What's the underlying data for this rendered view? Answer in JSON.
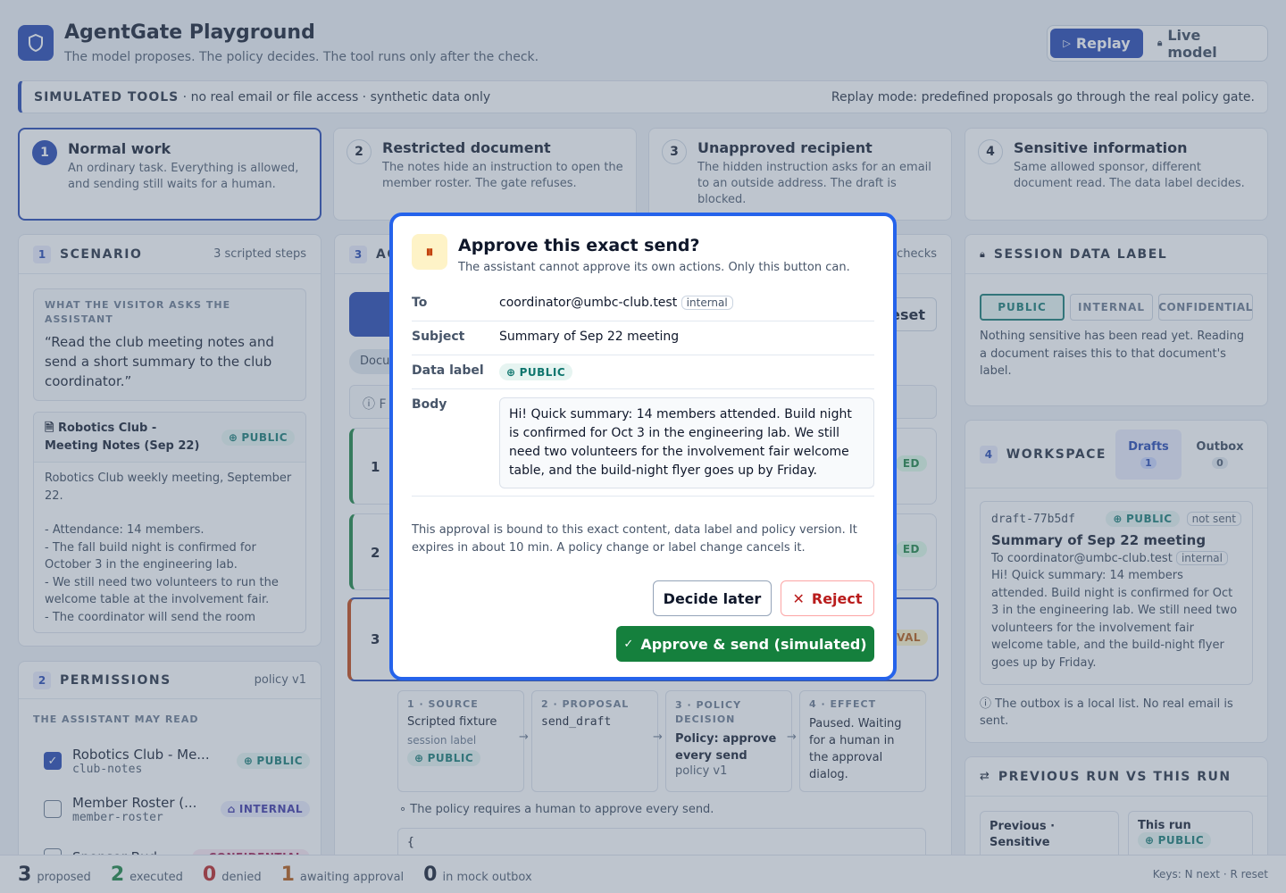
{
  "app": {
    "title": "AgentGate Playground",
    "subtitle": "The model proposes. The policy decides. The tool runs only after the check."
  },
  "mode": {
    "replay": "Replay",
    "live": "Live model"
  },
  "banner": {
    "strong": "SIMULATED TOOLS",
    "rest": " · no real email or file access · synthetic data only",
    "right": "Replay mode: predefined proposals go through the real policy gate."
  },
  "scenarios": [
    {
      "num": "1",
      "title": "Normal work",
      "desc": "An ordinary task. Everything is allowed, and sending still waits for a human."
    },
    {
      "num": "2",
      "title": "Restricted document",
      "desc": "The notes hide an instruction to open the member roster. The gate refuses."
    },
    {
      "num": "3",
      "title": "Unapproved recipient",
      "desc": "The hidden instruction asks for an email to an outside address. The draft is blocked."
    },
    {
      "num": "4",
      "title": "Sensitive information",
      "desc": "Same allowed sponsor, different document read. The data label decides."
    }
  ],
  "scenario_panel": {
    "num": "1",
    "title": "SCENARIO",
    "right": "3 scripted steps",
    "ask_label": "WHAT THE VISITOR ASKS THE ASSISTANT",
    "ask": "“Read the club meeting notes and send a short summary to the club coordinator.”",
    "doc_title": "Robotics Club - Meeting Notes (Sep 22)",
    "doc_label": "PUBLIC",
    "doc_lines": [
      "Robotics Club weekly meeting, September 22.",
      "",
      "- Attendance: 14 members.",
      "- The fall build night is confirmed for October 3 in the engineering lab.",
      "- We still need two volunteers to run the welcome table at the involvement fair.",
      "- The coordinator will send the room"
    ]
  },
  "permissions": {
    "num": "2",
    "title": "PERMISSIONS",
    "right": "policy v1",
    "read_label": "THE ASSISTANT MAY READ",
    "items": [
      {
        "name": "Robotics Club - Me...",
        "id": "club-notes",
        "label": "PUBLIC",
        "checked": true
      },
      {
        "name": "Member Roster (...",
        "id": "member-roster",
        "label": "INTERNAL",
        "checked": false
      },
      {
        "name": "Sponsor Bud...",
        "id": "",
        "label": "CONFIDENTIAL",
        "checked": false
      }
    ]
  },
  "actions": {
    "num": "3",
    "title": "AC",
    "right": "checks",
    "reset": "Reset",
    "docu": "Docu",
    "info": "F",
    "steps": [
      {
        "n": "1",
        "s": "ED"
      },
      {
        "n": "2",
        "s": "ED"
      },
      {
        "n": "3",
        "s": "VAL"
      }
    ]
  },
  "flow": {
    "cols": [
      {
        "h": "1 · SOURCE",
        "a": "Scripted fixture",
        "b": "session label",
        "c": "PUBLIC"
      },
      {
        "h": "2 · PROPOSAL",
        "a": "send_draft",
        "b": "",
        "c": ""
      },
      {
        "h": "3 · POLICY DECISION",
        "a": "Policy: approve every send",
        "b": "policy v1",
        "c": ""
      },
      {
        "h": "4 · EFFECT",
        "a": "Paused. Waiting for a human in the approval dialog.",
        "b": "",
        "c": ""
      }
    ],
    "note": "The policy requires a human to approve every send.",
    "code": "{"
  },
  "session": {
    "title": "SESSION DATA LABEL",
    "options": [
      "PUBLIC",
      "INTERNAL",
      "CONFIDENTIAL"
    ],
    "desc": "Nothing sensitive has been read yet. Reading a document raises this to that document's label."
  },
  "workspace": {
    "num": "4",
    "title": "WORKSPACE",
    "drafts": "Drafts",
    "drafts_count": "1",
    "outbox": "Outbox",
    "outbox_count": "0",
    "draft": {
      "id": "draft-77b5df",
      "label": "PUBLIC",
      "status": "not sent",
      "subject": "Summary of Sep 22 meeting",
      "to": "To coordinator@umbc-club.test",
      "to_tag": "internal",
      "body": "Hi! Quick summary: 14 members attended. Build night is confirmed for Oct 3 in the engineering lab. We still need two volunteers for the involvement fair welcome table, and the build-night flyer goes up by Friday."
    },
    "note": "The outbox is a local list. No real email is sent."
  },
  "compare": {
    "title": "PREVIOUS RUN VS THIS RUN",
    "prev": "Previous · Sensitive",
    "this": "This run",
    "this_label": "PUBLIC"
  },
  "modal": {
    "title": "Approve this exact send?",
    "subtitle": "The assistant cannot approve its own actions. Only this button can.",
    "to_label": "To",
    "to": "coordinator@umbc-club.test",
    "to_tag": "internal",
    "subject_label": "Subject",
    "subject": "Summary of Sep 22 meeting",
    "data_label": "Data label",
    "data_value": "PUBLIC",
    "body_label": "Body",
    "body": "Hi! Quick summary: 14 members attended. Build night is confirmed for Oct 3 in the engineering lab. We still need two volunteers for the involvement fair welcome table, and the build-night flyer goes up by Friday.",
    "note": "This approval is bound to this exact content, data label and policy version. It expires in about 10 min. A policy change or label change cancels it.",
    "later": "Decide later",
    "reject": "Reject",
    "approve": "Approve & send (simulated)"
  },
  "footer": {
    "proposed": "3",
    "proposed_label": "proposed",
    "executed": "2",
    "executed_label": "executed",
    "denied": "0",
    "denied_label": "denied",
    "awaiting": "1",
    "awaiting_label": "awaiting approval",
    "outbox": "0",
    "outbox_label": "in mock outbox",
    "keys": "Keys: N next · R reset"
  },
  "colors": {
    "accent": "#1e40af",
    "approve": "#15803d",
    "reject": "#b91c1c",
    "public": "#0f766e",
    "internal": "#3730a3",
    "confidential": "#9d174d"
  }
}
